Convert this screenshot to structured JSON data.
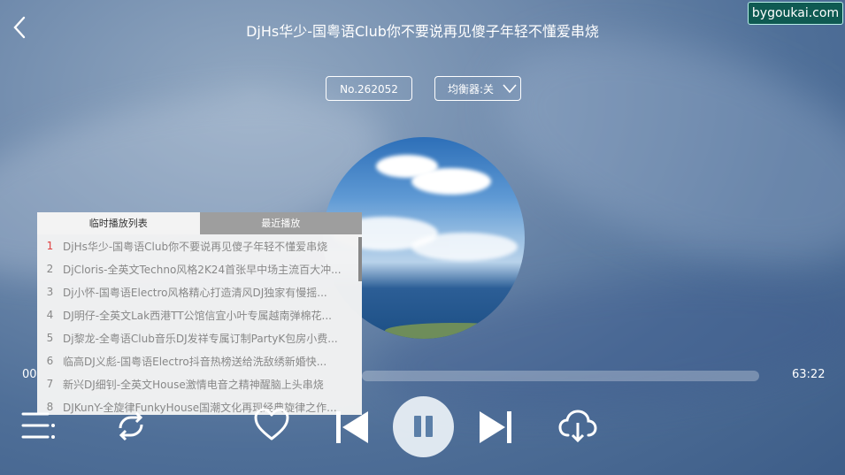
{
  "header": {
    "title": "DjHs华少-国粤语Club你不要说再见傻子年轻不懂爱串烧",
    "watermark": "bygoukai.com"
  },
  "badges": {
    "number": "No.262052",
    "equalizer": "均衡器:关"
  },
  "playlist": {
    "tabs": [
      {
        "label": "临时播放列表",
        "active": true
      },
      {
        "label": "最近播放",
        "active": false
      }
    ],
    "items": [
      {
        "num": "1",
        "name": "DjHs华少-国粤语Club你不要说再见傻子年轻不懂爱串烧",
        "playing": true
      },
      {
        "num": "2",
        "name": "DjCloris-全英文Techno风格2K24首张早中场主流百大冲..."
      },
      {
        "num": "3",
        "name": "Dj小怀-国粤语Electro风格精心打造清风DJ独家有慢摇..."
      },
      {
        "num": "4",
        "name": "DJ明仔-全英文Lak西港TT公馆信宜小叶专属越南弹棉花..."
      },
      {
        "num": "5",
        "name": "Dj黎龙-全粤语Club音乐DJ发祥专属订制PartyK包房小费..."
      },
      {
        "num": "6",
        "name": "临高DJ义彪-国粤语Electro抖音热榜送给洗敌绣新婚快..."
      },
      {
        "num": "7",
        "name": "新兴DJ细钊-全英文House激情电音之精神醒脑上头串烧"
      },
      {
        "num": "8",
        "name": "DJKunY-全旋律FunkyHouse国潮文化再现经典旋律之作..."
      }
    ]
  },
  "player": {
    "current_time": "00",
    "total_time": "63:22",
    "progress": 0.0
  },
  "controls": {
    "list_icon": "playlist-icon",
    "loop_icon": "loop-icon",
    "like_icon": "heart-icon",
    "prev_icon": "previous-icon",
    "play_icon": "pause-icon",
    "next_icon": "next-icon",
    "download_icon": "cloud-download-icon"
  },
  "colors": {
    "active_track_number": "#e04040",
    "watermark_bg": "#0f5a52"
  }
}
